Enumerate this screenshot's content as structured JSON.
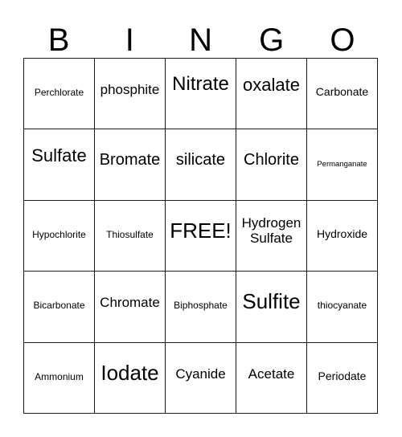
{
  "card": {
    "title": "BINGO",
    "header_letters": [
      "B",
      "I",
      "N",
      "G",
      "O"
    ],
    "columns": 5,
    "rows": 5,
    "free_space_label": "FREE!",
    "border_color": "#1a1a1a",
    "background_color": "#ffffff",
    "text_color": "#000000",
    "cells": [
      [
        {
          "label": "Perchlorate",
          "size": "xxs",
          "free": false
        },
        {
          "label": "phosphite",
          "size": "sm",
          "free": false
        },
        {
          "label": "Nitrate",
          "size": "xl",
          "free": false
        },
        {
          "label": "oxalate",
          "size": "lg",
          "free": false
        },
        {
          "label": "Carbonate",
          "size": "xs",
          "free": false
        }
      ],
      [
        {
          "label": "Sulfate",
          "size": "lg",
          "free": false
        },
        {
          "label": "Bromate",
          "size": "md",
          "free": false
        },
        {
          "label": "silicate",
          "size": "md",
          "free": false
        },
        {
          "label": "Chlorite",
          "size": "md",
          "free": false
        },
        {
          "label": "Permanganate",
          "size": "tiny",
          "free": false
        }
      ],
      [
        {
          "label": "Hypochlorite",
          "size": "xxs",
          "free": false
        },
        {
          "label": "Thiosulfate",
          "size": "xxs",
          "free": false
        },
        {
          "label": "FREE!",
          "size": "xxl",
          "free": true
        },
        {
          "label": "Hydrogen Sulfate",
          "size": "sm",
          "free": false,
          "two_line": true
        },
        {
          "label": "Hydroxide",
          "size": "xs",
          "free": false
        }
      ],
      [
        {
          "label": "Bicarbonate",
          "size": "xxs",
          "free": false
        },
        {
          "label": "Chromate",
          "size": "sm",
          "free": false
        },
        {
          "label": "Biphosphate",
          "size": "xxs",
          "free": false
        },
        {
          "label": "Sulfite",
          "size": "xxl",
          "free": false
        },
        {
          "label": "thiocyanate",
          "size": "xxs",
          "free": false
        }
      ],
      [
        {
          "label": "Ammonium",
          "size": "xxs",
          "free": false
        },
        {
          "label": "Iodate",
          "size": "xxl",
          "free": false
        },
        {
          "label": "Cyanide",
          "size": "sm",
          "free": false
        },
        {
          "label": "Acetate",
          "size": "sm",
          "free": false
        },
        {
          "label": "Periodate",
          "size": "xs",
          "free": false
        }
      ]
    ]
  }
}
